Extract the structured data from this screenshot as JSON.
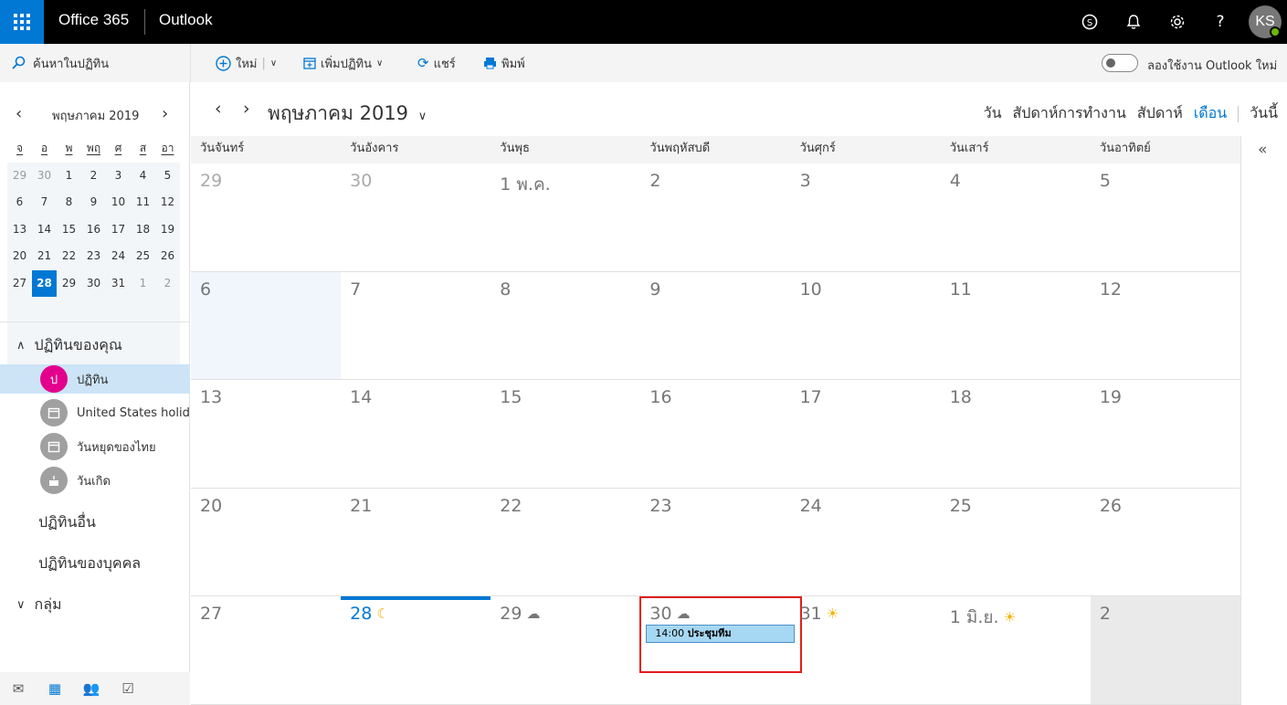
{
  "topbar": {
    "brand": "Office 365",
    "app_name": "Outlook",
    "avatar_initials": "KS",
    "icons": [
      "skype-icon",
      "bell-icon",
      "gear-icon",
      "help-icon"
    ]
  },
  "commandbar": {
    "search_label": "ค้นหาในปฏิทิน",
    "new_label": "ใหม่",
    "add_calendar_label": "เพิ่มปฏิทิน",
    "share_label": "แชร์",
    "print_label": "พิมพ์",
    "try_new_label": "ลองใช้งาน Outlook ใหม่"
  },
  "minical": {
    "title": "พฤษภาคม 2019",
    "weekdays": [
      "จ",
      "อ",
      "พ",
      "พฤ",
      "ศ",
      "ส",
      "อา"
    ],
    "weeks": [
      [
        {
          "d": "29",
          "dim": true
        },
        {
          "d": "30",
          "dim": true
        },
        {
          "d": "1"
        },
        {
          "d": "2"
        },
        {
          "d": "3"
        },
        {
          "d": "4"
        },
        {
          "d": "5"
        }
      ],
      [
        {
          "d": "6"
        },
        {
          "d": "7"
        },
        {
          "d": "8"
        },
        {
          "d": "9"
        },
        {
          "d": "10"
        },
        {
          "d": "11"
        },
        {
          "d": "12"
        }
      ],
      [
        {
          "d": "13"
        },
        {
          "d": "14"
        },
        {
          "d": "15"
        },
        {
          "d": "16"
        },
        {
          "d": "17"
        },
        {
          "d": "18"
        },
        {
          "d": "19"
        }
      ],
      [
        {
          "d": "20"
        },
        {
          "d": "21"
        },
        {
          "d": "22"
        },
        {
          "d": "23"
        },
        {
          "d": "24"
        },
        {
          "d": "25"
        },
        {
          "d": "26"
        }
      ],
      [
        {
          "d": "27"
        },
        {
          "d": "28",
          "today": true
        },
        {
          "d": "29"
        },
        {
          "d": "30"
        },
        {
          "d": "31"
        },
        {
          "d": "1",
          "dim": true
        },
        {
          "d": "2",
          "dim": true
        }
      ]
    ]
  },
  "sidebar": {
    "your_calendars": "ปฏิทินของคุณ",
    "calendars": [
      {
        "label": "ปฏิทิน",
        "badge": "ป",
        "color": "#e3008c",
        "selected": true
      },
      {
        "label": "United States holidays",
        "badge": "",
        "color": "#a0a0a0",
        "selected": false
      },
      {
        "label": "วันหยุดของไทย",
        "badge": "",
        "color": "#a0a0a0",
        "selected": false
      },
      {
        "label": "วันเกิด",
        "badge": "",
        "color": "#a0a0a0",
        "selected": false
      }
    ],
    "other_calendars": "ปฏิทินอื่น",
    "people_calendars": "ปฏิทินของบุคคล",
    "groups": "กลุ่ม"
  },
  "main": {
    "title": "พฤษภาคม 2019",
    "views": [
      {
        "label": "วัน",
        "active": false
      },
      {
        "label": "สัปดาห์การทำงาน",
        "active": false
      },
      {
        "label": "สัปดาห์",
        "active": false
      },
      {
        "label": "เดือน",
        "active": true
      },
      {
        "label": "วันนี้",
        "active": false
      }
    ],
    "weekday_headers": [
      "วันจันทร์",
      "วันอังคาร",
      "วันพุธ",
      "วันพฤหัสบดี",
      "วันศุกร์",
      "วันเสาร์",
      "วันอาทิตย์"
    ],
    "weeks": [
      [
        {
          "d": "29",
          "dim": true
        },
        {
          "d": "30",
          "dim": true
        },
        {
          "d": "1 พ.ค."
        },
        {
          "d": "2"
        },
        {
          "d": "3"
        },
        {
          "d": "4"
        },
        {
          "d": "5"
        }
      ],
      [
        {
          "d": "6",
          "shade": true
        },
        {
          "d": "7"
        },
        {
          "d": "8"
        },
        {
          "d": "9"
        },
        {
          "d": "10"
        },
        {
          "d": "11"
        },
        {
          "d": "12"
        }
      ],
      [
        {
          "d": "13"
        },
        {
          "d": "14"
        },
        {
          "d": "15"
        },
        {
          "d": "16"
        },
        {
          "d": "17"
        },
        {
          "d": "18"
        },
        {
          "d": "19"
        }
      ],
      [
        {
          "d": "20"
        },
        {
          "d": "21"
        },
        {
          "d": "22"
        },
        {
          "d": "23"
        },
        {
          "d": "24"
        },
        {
          "d": "25"
        },
        {
          "d": "26"
        }
      ],
      [
        {
          "d": "27"
        },
        {
          "d": "28",
          "today": true,
          "wx": "☾"
        },
        {
          "d": "29",
          "wx": "☁"
        },
        {
          "d": "30",
          "wx": "☁",
          "event": {
            "time": "14:00",
            "title": "ประชุมทีม"
          },
          "highlight": true
        },
        {
          "d": "31",
          "wx": "☀"
        },
        {
          "d": "1 มิ.ย.",
          "wx": "☀"
        },
        {
          "d": "2",
          "nextm": true
        }
      ]
    ]
  },
  "colors": {
    "accent": "#0078d4",
    "highlight": "#e31b1b"
  }
}
